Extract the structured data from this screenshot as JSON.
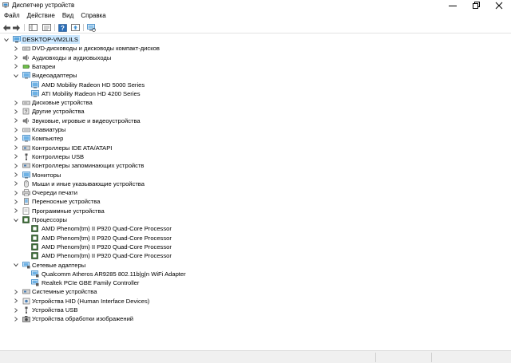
{
  "window": {
    "title": "Диспетчер устройств"
  },
  "menu": [
    "Файл",
    "Действие",
    "Вид",
    "Справка"
  ],
  "toolbar": [
    "back-icon",
    "forward-icon",
    "properties-icon",
    "help-icon",
    "scan-hardware-icon"
  ],
  "tree": {
    "root": "DESKTOP-VM2LILS",
    "categories": [
      {
        "label": "DVD-дисководы и дисководы компакт-дисков",
        "icon": "dvd-drive-icon",
        "expanded": false,
        "children": []
      },
      {
        "label": "Аудиовходы и аудиовыходы",
        "icon": "speaker-icon",
        "expanded": false,
        "children": []
      },
      {
        "label": "Батареи",
        "icon": "battery-icon",
        "expanded": false,
        "children": []
      },
      {
        "label": "Видеоадаптеры",
        "icon": "display-adapter-icon",
        "expanded": true,
        "children": [
          {
            "label": "AMD Mobility Radeon HD 5000 Series",
            "icon": "display-adapter-icon"
          },
          {
            "label": "ATI Mobility Radeon HD 4200 Series",
            "icon": "display-adapter-icon"
          }
        ]
      },
      {
        "label": "Дисковые устройства",
        "icon": "disk-drive-icon",
        "expanded": false,
        "children": []
      },
      {
        "label": "Другие устройства",
        "icon": "unknown-device-icon",
        "expanded": false,
        "children": []
      },
      {
        "label": "Звуковые, игровые и видеоустройства",
        "icon": "sound-icon",
        "expanded": false,
        "children": []
      },
      {
        "label": "Клавиатуры",
        "icon": "keyboard-icon",
        "expanded": false,
        "children": []
      },
      {
        "label": "Компьютер",
        "icon": "computer-icon",
        "expanded": false,
        "children": []
      },
      {
        "label": "Контроллеры IDE ATA/ATAPI",
        "icon": "ide-controller-icon",
        "expanded": false,
        "children": []
      },
      {
        "label": "Контроллеры USB",
        "icon": "usb-icon",
        "expanded": false,
        "children": []
      },
      {
        "label": "Контроллеры запоминающих устройств",
        "icon": "storage-controller-icon",
        "expanded": false,
        "children": []
      },
      {
        "label": "Мониторы",
        "icon": "monitor-icon",
        "expanded": false,
        "children": []
      },
      {
        "label": "Мыши и иные указывающие устройства",
        "icon": "mouse-icon",
        "expanded": false,
        "children": []
      },
      {
        "label": "Очереди печати",
        "icon": "printer-icon",
        "expanded": false,
        "children": []
      },
      {
        "label": "Переносные устройства",
        "icon": "portable-device-icon",
        "expanded": false,
        "children": []
      },
      {
        "label": "Программные устройства",
        "icon": "software-device-icon",
        "expanded": false,
        "children": []
      },
      {
        "label": "Процессоры",
        "icon": "processor-icon",
        "expanded": true,
        "children": [
          {
            "label": "AMD Phenom(tm) II P920 Quad-Core Processor",
            "icon": "processor-icon"
          },
          {
            "label": "AMD Phenom(tm) II P920 Quad-Core Processor",
            "icon": "processor-icon"
          },
          {
            "label": "AMD Phenom(tm) II P920 Quad-Core Processor",
            "icon": "processor-icon"
          },
          {
            "label": "AMD Phenom(tm) II P920 Quad-Core Processor",
            "icon": "processor-icon"
          }
        ]
      },
      {
        "label": "Сетевые адаптеры",
        "icon": "network-adapter-icon",
        "expanded": true,
        "children": [
          {
            "label": "Qualcomm Atheros AR9285 802.11b|g|n WiFi Adapter",
            "icon": "network-adapter-icon"
          },
          {
            "label": "Realtek PCIe GBE Family Controller",
            "icon": "network-adapter-icon"
          }
        ]
      },
      {
        "label": "Системные устройства",
        "icon": "system-device-icon",
        "expanded": false,
        "children": []
      },
      {
        "label": "Устройства HID (Human Interface Devices)",
        "icon": "hid-icon",
        "expanded": false,
        "children": []
      },
      {
        "label": "Устройства USB",
        "icon": "usb-icon",
        "expanded": false,
        "children": []
      },
      {
        "label": "Устройства обработки изображений",
        "icon": "camera-icon",
        "expanded": false,
        "children": []
      }
    ]
  },
  "colors": {
    "selection": "#cce8ff",
    "monitor_blue": "#2f7fc1",
    "processor_green": "#3a6b35",
    "icon_gray": "#6b6b6b"
  }
}
